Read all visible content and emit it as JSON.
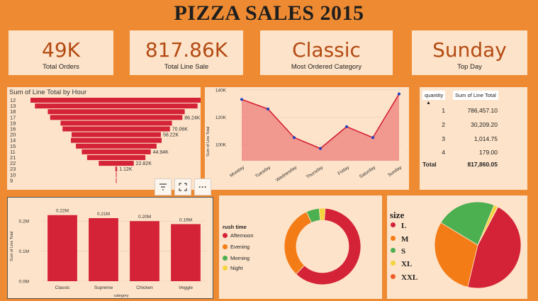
{
  "title": "PIZZA SALES 2015",
  "kpis": [
    {
      "value": "49K",
      "label": "Total Orders"
    },
    {
      "value": "817.86K",
      "label": "Total Line Sale"
    },
    {
      "value": "Classic",
      "label": "Most Ordered Category"
    },
    {
      "value": "Sunday",
      "label": "Top Day"
    }
  ],
  "colors": {
    "accent": "#d42237",
    "orange": "#f47c17",
    "green": "#4caf50",
    "yellow": "#f5d33b",
    "bg": "#ee8a32",
    "card": "#fde3c9"
  },
  "toolbar": {
    "icons": [
      "filter-icon",
      "focus-mode-icon",
      "more-options-icon"
    ],
    "more_label": "···"
  },
  "quantity_table": {
    "headers": [
      "quantity",
      "Sum of Line Total"
    ],
    "rows": [
      {
        "quantity": "1",
        "sum": "786,457.10"
      },
      {
        "quantity": "2",
        "sum": "30,209.20"
      },
      {
        "quantity": "3",
        "sum": "1,014.75"
      },
      {
        "quantity": "4",
        "sum": "179.00"
      }
    ],
    "total_label": "Total",
    "total_value": "817,860.05"
  },
  "chart_data": [
    {
      "type": "bar",
      "orientation": "horizontal",
      "title": "Sum of Line Total by Hour",
      "categories": [
        "12",
        "13",
        "18",
        "17",
        "19",
        "16",
        "20",
        "14",
        "15",
        "11",
        "21",
        "22",
        "23",
        "10",
        "9"
      ],
      "values": [
        111880,
        106070,
        89300,
        86240,
        72630,
        70060,
        58220,
        59200,
        52600,
        44940,
        38000,
        22820,
        1120,
        300,
        80
      ],
      "data_labels": {
        "3": "86.24K",
        "5": "70.06K",
        "6": "58.22K",
        "9": "44.94K",
        "11": "22.82K",
        "12": "1.12K"
      },
      "color": "#d42237"
    },
    {
      "type": "area",
      "title": "",
      "categories": [
        "Monday",
        "Tuesday",
        "Wednesday",
        "Thursday",
        "Friday",
        "Saturday",
        "Sunday"
      ],
      "values": [
        133000,
        126000,
        105000,
        97000,
        113000,
        105000,
        137000
      ],
      "ylabel": "Sum of Line Total",
      "yticks": [
        "140K",
        "120K",
        "100K"
      ],
      "ytick_values": [
        140000,
        120000,
        100000
      ],
      "ylim": [
        88000,
        142000
      ],
      "color": "#d42237"
    },
    {
      "type": "bar",
      "title": "",
      "categories": [
        "Classic",
        "Supreme",
        "Chicken",
        "Veggie"
      ],
      "values": [
        0.22,
        0.21,
        0.2,
        0.19
      ],
      "data_labels": [
        "0.22M",
        "0.21M",
        "0.20M",
        "0.19M"
      ],
      "xlabel": "category",
      "ylabel": "Sum of Line Total",
      "yticks": [
        "0.2M",
        "0.1M",
        "0.0M"
      ],
      "ytick_values": [
        0.2,
        0.1,
        0.0
      ],
      "ylim": [
        0,
        0.25
      ],
      "color": "#d42237"
    },
    {
      "type": "pie",
      "variant": "donut",
      "title": "rush time",
      "labels": [
        "Afternoon",
        "Evening",
        "Morning",
        "Night"
      ],
      "values": [
        61,
        31,
        5.5,
        2.5
      ],
      "colors": [
        "#d42237",
        "#f47c17",
        "#4caf50",
        "#f5d33b"
      ]
    },
    {
      "type": "pie",
      "title": "size",
      "labels": [
        "L",
        "M",
        "S",
        "XL",
        "XXL"
      ],
      "values": [
        46,
        30,
        22.5,
        1.5,
        0.1
      ],
      "colors": [
        "#d42237",
        "#f47c17",
        "#4caf50",
        "#f5d33b",
        "#f25c2a"
      ]
    }
  ]
}
